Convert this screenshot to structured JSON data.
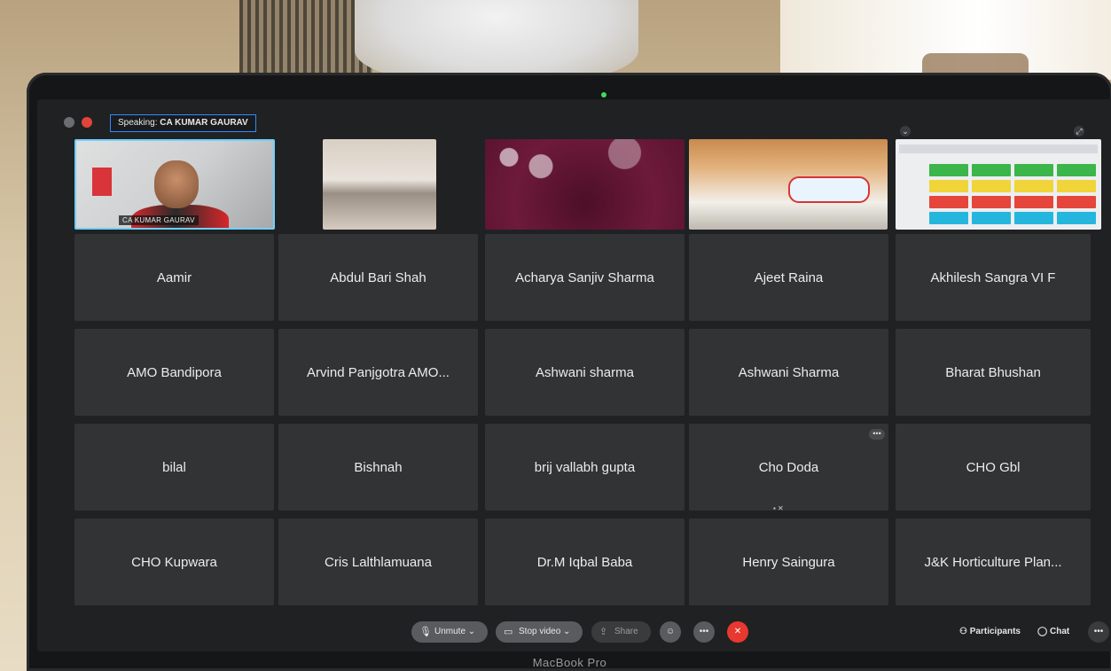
{
  "speaking": {
    "label": "Speaking:",
    "name": "CA KUMAR GAURAV"
  },
  "video_strip": {
    "presenter_label": "CA KUMAR GAURAV"
  },
  "participants": [
    "Aamir",
    "Abdul Bari Shah",
    "Acharya Sanjiv Sharma",
    "Ajeet Raina",
    "Akhilesh Sangra VI F",
    "AMO Bandipora",
    "Arvind Panjgotra AMO...",
    "Ashwani sharma",
    "Ashwani Sharma",
    "Bharat Bhushan",
    "bilal",
    "Bishnah",
    "brij vallabh gupta",
    "Cho Doda",
    "CHO Gbl",
    "CHO Kupwara",
    "Cris Lalthlamuana",
    "Dr.M Iqbal Baba",
    "Henry Saingura",
    "J&K Horticulture Plan..."
  ],
  "toolbar": {
    "unmute": "Unmute",
    "stop_video": "Stop video",
    "share": "Share",
    "participants": "Participants",
    "chat": "Chat"
  },
  "device_label": "MacBook Pro",
  "icons": {
    "mic": "mic-muted-icon",
    "video": "video-camera-icon",
    "share": "share-screen-icon",
    "reactions": "reaction-icon",
    "more": "more-icon",
    "end": "end-call-icon",
    "participants": "participants-icon",
    "chat": "chat-icon"
  },
  "colors": {
    "accent": "#2d8cff",
    "end_call": "#e8382f",
    "tile": "#323335"
  }
}
